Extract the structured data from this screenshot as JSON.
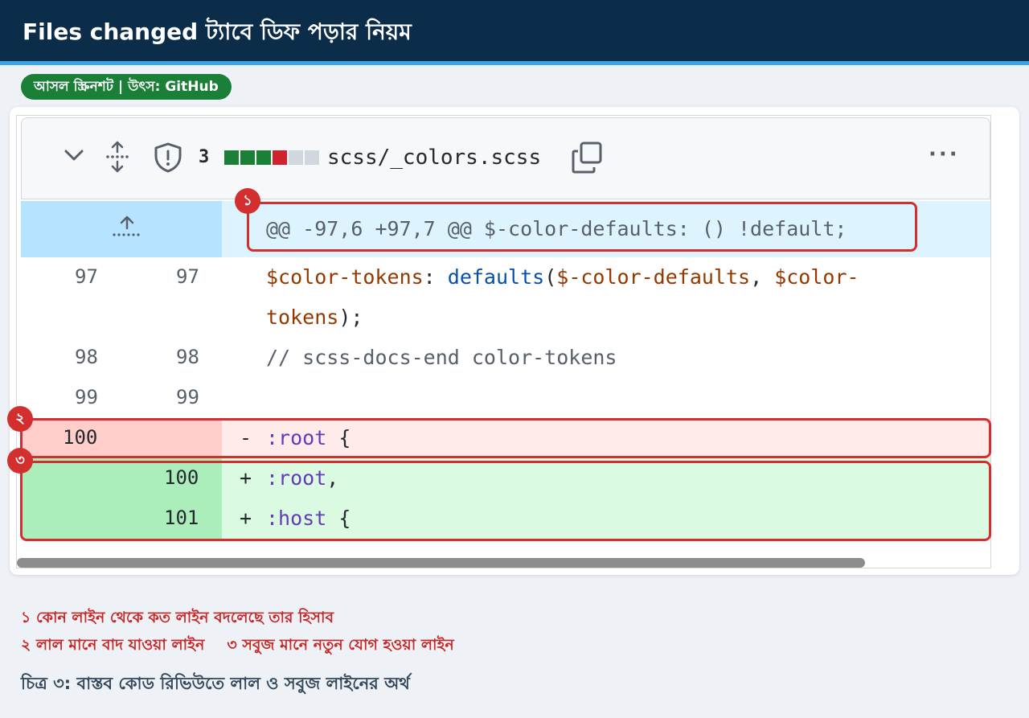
{
  "header": {
    "title": "Files changed ট্যাবে ডিফ পড়ার নিয়ম"
  },
  "badge": {
    "label": "আসল স্ক্রিনশট | উৎস: GitHub"
  },
  "file_header": {
    "count": "3",
    "diffstat": [
      "#1a7f37",
      "#1a7f37",
      "#1a7f37",
      "#cf222e",
      "#d0d7de",
      "#d0d7de"
    ],
    "filename": "scss/_colors.scss",
    "more": "···"
  },
  "diff": {
    "hunk": "@@ -97,6 +97,7 @@ $-color-defaults: () !default;",
    "lines": [
      {
        "old": "97",
        "new": "97",
        "p1": "$color-tokens",
        "p2": ": ",
        "p3": "defaults",
        "p4": "(",
        "p5": "$-color-defaults",
        "p6": ", ",
        "p7": "$color-",
        "cont": "tokens",
        "cont_end": ");"
      },
      {
        "old": "98",
        "new": "98",
        "comment": "// scss-docs-end color-tokens"
      },
      {
        "old": "99",
        "new": "99"
      }
    ],
    "deleted": {
      "old": "100",
      "sign": "-",
      "sel": ":root",
      "rest": " {"
    },
    "added": [
      {
        "new": "100",
        "sign": "+",
        "sel": ":root",
        "rest": ","
      },
      {
        "new": "101",
        "sign": "+",
        "sel": ":host",
        "rest": " {"
      }
    ]
  },
  "markers": [
    "১",
    "২",
    "৩"
  ],
  "legend": {
    "l1": "১ কোন লাইন থেকে কত লাইন বদলেছে তার হিসাব",
    "l2a": "২ লাল মানে বাদ যাওয়া লাইন",
    "l2b": "৩ সবুজ মানে নতুন যোগ হওয়া লাইন"
  },
  "caption": "চিত্র ৩: বাস্তব কোড রিভিউতে লাল ও সবুজ লাইনের অর্থ"
}
